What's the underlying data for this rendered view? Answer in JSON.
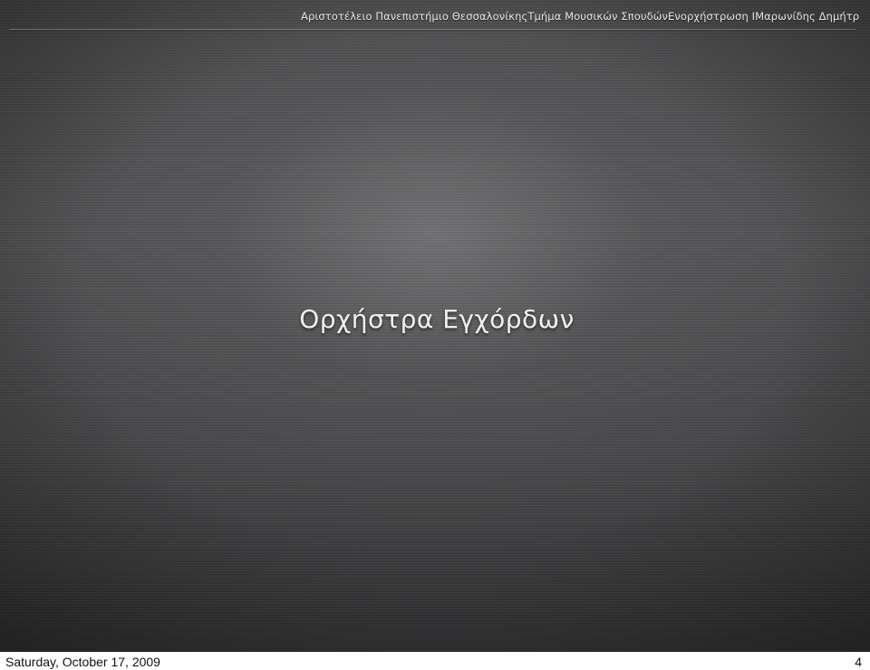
{
  "slide": {
    "header": {
      "university": "Αριστοτέλειο Πανεπιστήμιο Θεσσαλονίκης",
      "department": "Τμήμα Μουσικών Σπουδών",
      "course": "Ενορχήστρωση Ι",
      "author": "Μαρωνίδης Δημήτρ"
    },
    "title": "Ορχήστρα Εγχόρδων"
  },
  "footer": {
    "date": "Saturday, October 17, 2009",
    "page_number": "4"
  }
}
